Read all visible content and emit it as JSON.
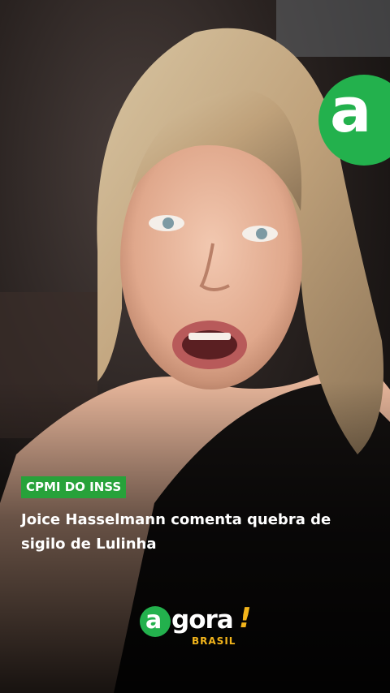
{
  "tag": {
    "label": "CPMI DO INSS",
    "color": "#27a23a"
  },
  "headline": {
    "text": "Joice Hasselmann comenta quebra de sigilo de Lulinha"
  },
  "corner_logo": {
    "letter": "a",
    "color": "#23b14d"
  },
  "brand": {
    "mark_letter": "a",
    "wordmark": "gora",
    "exclamation": "!",
    "subtitle": "BRASIL",
    "accent": "#f3b51b"
  }
}
